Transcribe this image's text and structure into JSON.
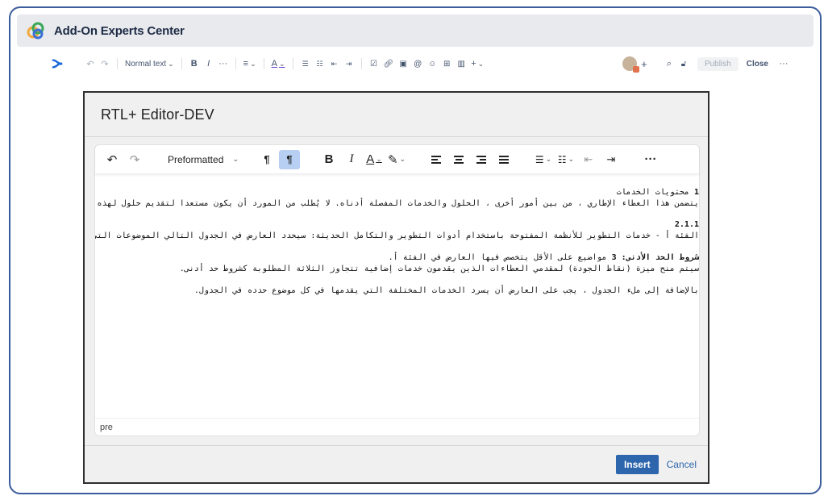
{
  "app": {
    "title": "Add-On Experts Center"
  },
  "confluence_toolbar": {
    "text_style": "Normal text",
    "publish_label": "Publish",
    "close_label": "Close",
    "icons": [
      "confluence-logo-icon",
      "undo-icon",
      "redo-icon",
      "bold-icon",
      "italic-icon",
      "more-formatting-icon",
      "align-icon",
      "text-color-icon",
      "bullet-list-icon",
      "numbered-list-icon",
      "outdent-icon",
      "indent-icon",
      "task-icon",
      "link-icon",
      "image-icon",
      "mention-icon",
      "emoji-icon",
      "table-icon",
      "layout-icon",
      "insert-plus-icon",
      "avatar",
      "add-collaborator-icon",
      "search-icon",
      "lock-icon",
      "more-icon"
    ]
  },
  "modal": {
    "title": "RTL+ Editor-DEV",
    "block_format": "Preformatted",
    "status_path": "pre",
    "insert_label": "Insert",
    "cancel_label": "Cancel",
    "content": {
      "line1_num": "1",
      "line1": "محتويات الخدمات",
      "line2": "يتضمن هذا العطاء الإطاري ، من بين أمور أخرى ، الحلول والخدمات المفصلة أدناه. لا يُطلب من المورد أن يكون مستعدا لتقديم حلول لهذه ا",
      "line3": "2.1.1",
      "line4": "الفئة أ - خدمات التطوير للأنظمة المفتوحة باستخدام أدوات التطوير والتكامل الحديثة: سيحدد العارض في الجدول التالي الموضوعات التي",
      "line5_label": "شروط الحد الأدنى: 3",
      "line5": " مواضيع على الأقل يتخصص فيها العارض في الفئة أ.",
      "line6": "سيتم منح ميزة (نقاط الجودة) لمقدمي العطاءات الذين يقدمون خدمات إضافية تتجاوز الثلاثة المطلوبة كشروط حد أدنى.",
      "line7": "بالإضافة إلى ملء الجدول ، يجب على العارض أن يسرد الخدمات المختلفة التي يقدمها في كل موضوع حدده في الجدول."
    }
  },
  "colors": {
    "frame_border": "#3b5c9c",
    "header_bg": "#e8eaee",
    "active_button": "#b6cff3",
    "insert_button": "#2d66ad"
  }
}
